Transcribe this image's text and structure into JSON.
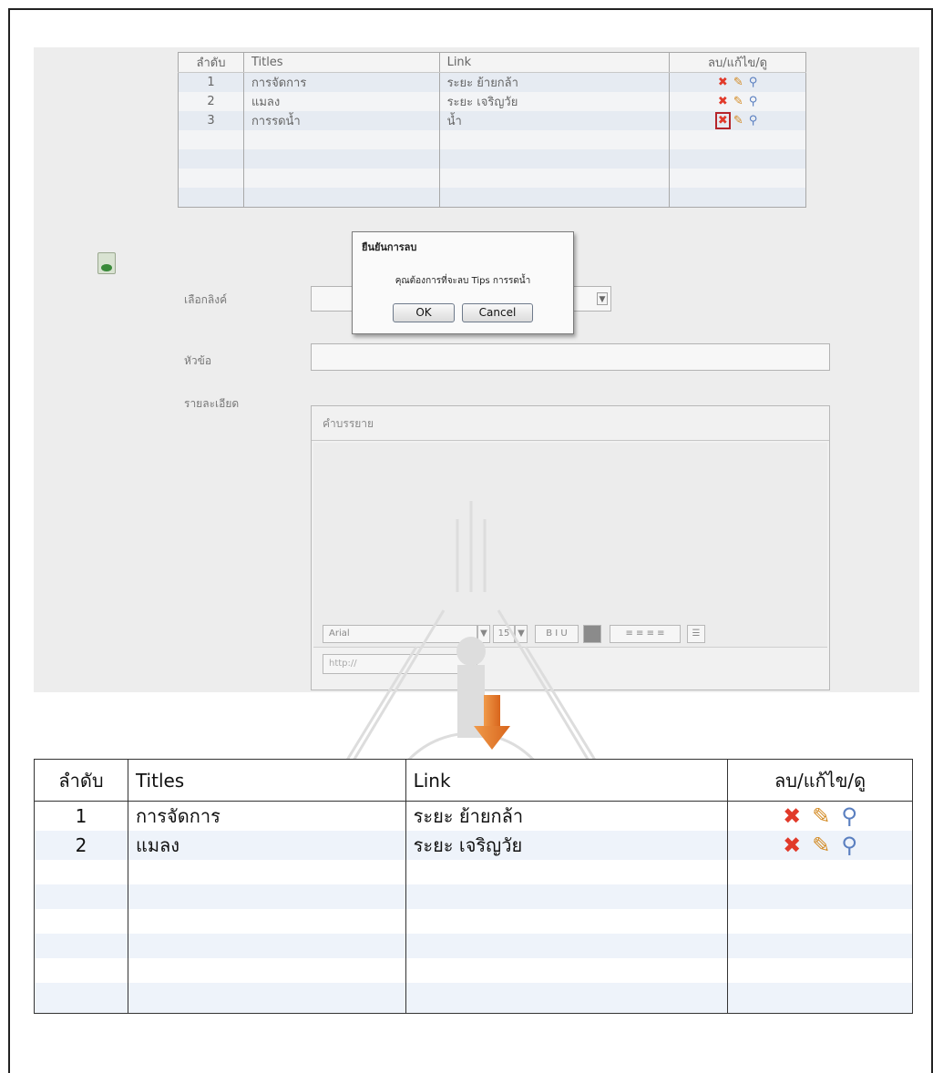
{
  "upper_table": {
    "headers": [
      "ลำดับ",
      "Titles",
      "Link",
      "ลบ/แก้ไข/ดู"
    ],
    "rows": [
      {
        "no": "1",
        "title": "การจัดการ",
        "link": "ระยะ ย้ายกล้า"
      },
      {
        "no": "2",
        "title": "แมลง",
        "link": "ระยะ เจริญวัย"
      },
      {
        "no": "3",
        "title": "การรดน้ำ",
        "link": "น้ำ"
      }
    ],
    "empty_rows": 4
  },
  "form": {
    "select_label": "เลือกลิงค์",
    "title_label": "หัวข้อ",
    "detail_label": "รายละเอียด",
    "editor_heading": "คำบรรยาย",
    "font_value": "Arial",
    "size_value": "15",
    "url_placeholder": "http://"
  },
  "dialog": {
    "title": "ยืนยันการลบ",
    "message": "คุณต้องการที่จะลบ Tips การรดน้ำ",
    "ok": "OK",
    "cancel": "Cancel"
  },
  "lower_table": {
    "headers": [
      "ลำดับ",
      "Titles",
      "Link",
      "ลบ/แก้ไข/ดู"
    ],
    "rows": [
      {
        "no": "1",
        "title": "การจัดการ",
        "link": "ระยะ ย้ายกล้า"
      },
      {
        "no": "2",
        "title": "แมลง",
        "link": "ระยะ เจริญวัย"
      }
    ],
    "empty_rows": 6
  },
  "icons": {
    "delete": "delete-icon",
    "edit": "edit-icon",
    "view": "view-icon"
  },
  "colors": {
    "delete": "#e13a2a",
    "edit": "#d38a23",
    "view": "#5a7fc0",
    "arrow": "#e8782a",
    "highlight": "#b5242a"
  }
}
